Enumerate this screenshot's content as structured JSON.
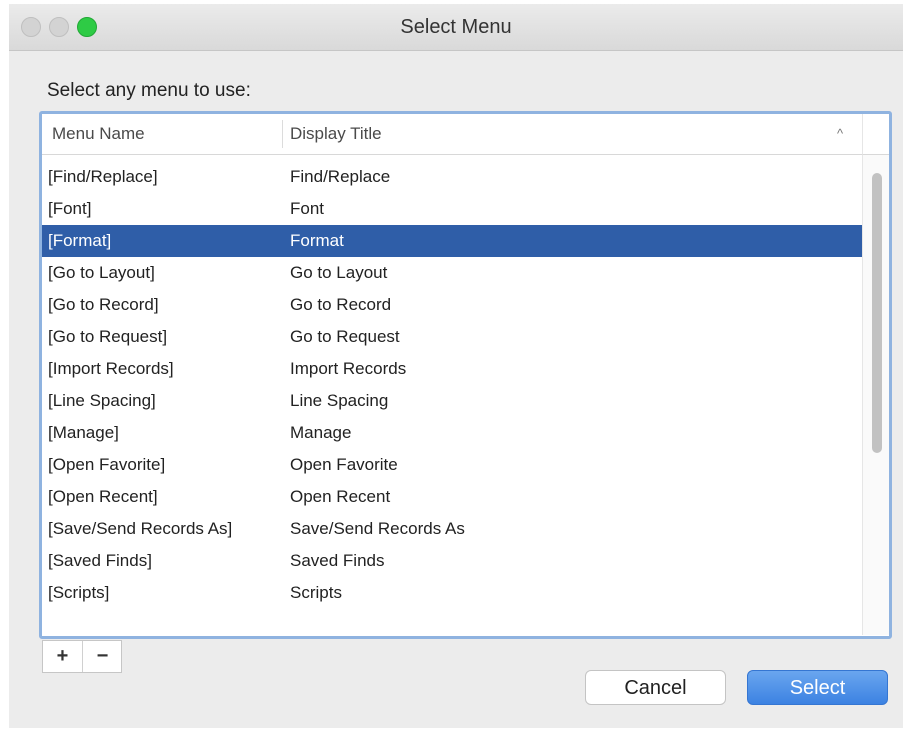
{
  "window": {
    "title": "Select Menu"
  },
  "prompt": "Select any menu to use:",
  "table": {
    "columns": {
      "name": "Menu Name",
      "title": "Display Title"
    },
    "sort_icon": "^",
    "rows": [
      {
        "name": "[Find/Replace]",
        "title": "Find/Replace"
      },
      {
        "name": "[Font]",
        "title": "Font"
      },
      {
        "name": "[Format]",
        "title": "Format",
        "selected": true
      },
      {
        "name": "[Go to Layout]",
        "title": "Go to Layout"
      },
      {
        "name": "[Go to Record]",
        "title": "Go to Record"
      },
      {
        "name": "[Go to Request]",
        "title": "Go to Request"
      },
      {
        "name": "[Import Records]",
        "title": "Import Records"
      },
      {
        "name": "[Line Spacing]",
        "title": "Line Spacing"
      },
      {
        "name": "[Manage]",
        "title": "Manage"
      },
      {
        "name": "[Open Favorite]",
        "title": "Open Favorite"
      },
      {
        "name": "[Open Recent]",
        "title": "Open Recent"
      },
      {
        "name": "[Save/Send Records As]",
        "title": "Save/Send Records As"
      },
      {
        "name": "[Saved Finds]",
        "title": "Saved Finds"
      },
      {
        "name": "[Scripts]",
        "title": "Scripts"
      }
    ]
  },
  "controls": {
    "add_label": "+",
    "remove_label": "−"
  },
  "buttons": {
    "cancel": "Cancel",
    "select": "Select"
  },
  "colors": {
    "selection": "#2f5ea8",
    "focus_ring": "#8fb3e0",
    "primary_button": "#4a8ee8",
    "zoom_button": "#2ecb45"
  }
}
